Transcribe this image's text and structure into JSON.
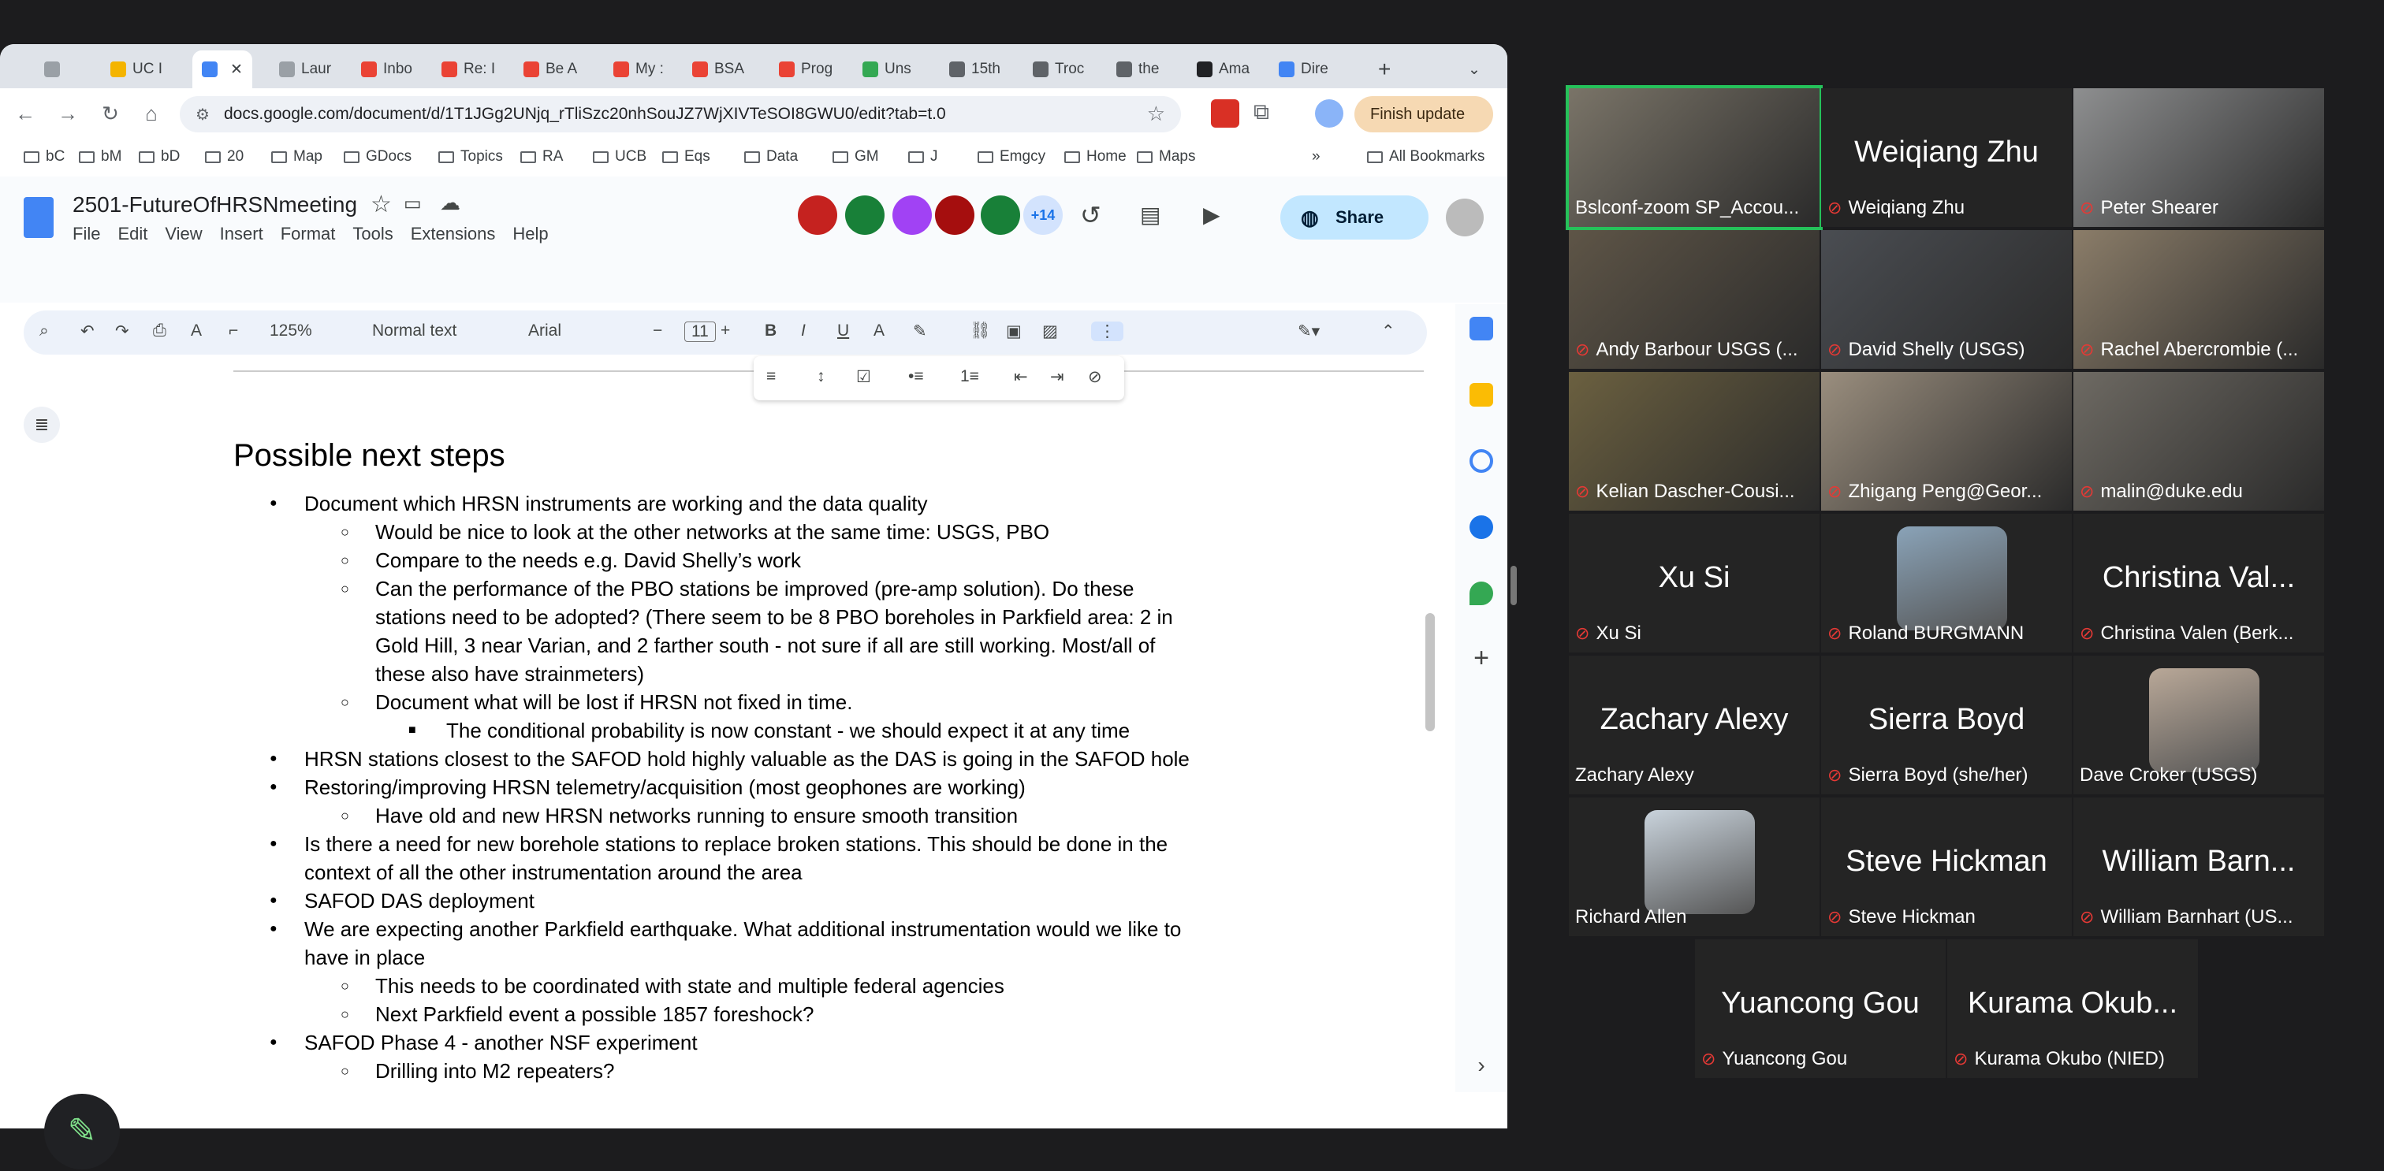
{
  "browser": {
    "tabs": [
      {
        "label": "UC I",
        "color": "#f4b400"
      },
      {
        "label": "",
        "color": "#4285f4",
        "active": true
      },
      {
        "label": "Laur",
        "color": "#9aa0a6"
      },
      {
        "label": "Inbo",
        "color": "#ea4335"
      },
      {
        "label": "Re: I",
        "color": "#ea4335"
      },
      {
        "label": "Be A",
        "color": "#ea4335"
      },
      {
        "label": "My :",
        "color": "#ea4335"
      },
      {
        "label": "BSA",
        "color": "#ea4335"
      },
      {
        "label": "Prog",
        "color": "#ea4335"
      },
      {
        "label": "Uns",
        "color": "#34a853"
      },
      {
        "label": "15th",
        "color": "#5f6368"
      },
      {
        "label": "Troc",
        "color": "#5f6368"
      },
      {
        "label": "the",
        "color": "#5f6368"
      },
      {
        "label": "Ama",
        "color": "#202124"
      },
      {
        "label": "Dire",
        "color": "#4285f4"
      }
    ],
    "url": "docs.google.com/document/d/1T1JGg2UNjq_rTliSzc20nhSouJZ7WjXIVTeSOI8GWU0/edit?tab=t.0",
    "finish_update": "Finish update",
    "bookmarks": [
      "bC",
      "bM",
      "bD",
      "20",
      "Map",
      "GDocs",
      "Topics",
      "RA",
      "UCB",
      "Eqs",
      "Data",
      "GM",
      "J",
      "Emgcy",
      "Home",
      "Maps"
    ],
    "more_bookmarks": "»",
    "all_bookmarks": "All Bookmarks"
  },
  "docs": {
    "title": "2501-FutureOfHRSNmeeting",
    "menus": [
      "File",
      "Edit",
      "View",
      "Insert",
      "Format",
      "Tools",
      "Extensions",
      "Help"
    ],
    "viewer_count": "+14",
    "share_label": "Share",
    "zoom": "125%",
    "style": "Normal text",
    "font": "Arial",
    "font_size": "11",
    "heading": "Possible next steps",
    "lines": [
      {
        "level": 1,
        "text": "Document which HRSN instruments are working and the data quality"
      },
      {
        "level": 2,
        "text": "Would be nice to look at the other networks at the same time: USGS, PBO"
      },
      {
        "level": 2,
        "text": "Compare to the needs e.g. David Shelly’s work"
      },
      {
        "level": 2,
        "text": "Can the performance of the PBO stations be improved (pre-amp solution).  Do these"
      },
      {
        "level": 0,
        "text": "stations need to be adopted? (There seem to be 8 PBO boreholes in Parkfield area: 2 in"
      },
      {
        "level": 0,
        "text": "Gold Hill, 3 near Varian, and 2 farther south - not sure if all are still working.  Most/all of"
      },
      {
        "level": 0,
        "text": "these also have strainmeters)"
      },
      {
        "level": 2,
        "text": "Document what will be lost if HRSN not fixed in time."
      },
      {
        "level": 3,
        "text": "The conditional probability is now constant - we should expect it at any time"
      },
      {
        "level": 1,
        "text": "HRSN stations closest to the SAFOD hold highly valuable as the DAS is going in the SAFOD hole"
      },
      {
        "level": 1,
        "text": "Restoring/improving HRSN telemetry/acquisition (most geophones are working)"
      },
      {
        "level": 2,
        "text": "Have old and new HRSN networks running to ensure smooth transition"
      },
      {
        "level": 1,
        "text": "Is there a need for new borehole stations to replace broken stations.  This should be done in the"
      },
      {
        "level": -1,
        "text": "context of all the other instrumentation around the area"
      },
      {
        "level": 1,
        "text": "SAFOD DAS deployment"
      },
      {
        "level": 1,
        "text": "We are expecting another Parkfield earthquake.  What additional instrumentation would we like to"
      },
      {
        "level": -1,
        "text": "have in place"
      },
      {
        "level": 2,
        "text": "This needs to be coordinated with state and multiple federal agencies"
      },
      {
        "level": 2,
        "text": "Next Parkfield event a possible 1857 foreshock?"
      },
      {
        "level": 1,
        "text": "SAFOD Phase 4 - another NSF experiment"
      },
      {
        "level": 2,
        "text": "Drilling into M2 repeaters?"
      }
    ]
  },
  "zoom": {
    "participants": [
      {
        "label": "Bslconf-zoom SP_Accou...",
        "video": "#7a7468",
        "muted": false,
        "highlight": true
      },
      {
        "label": "Weiqiang Zhu",
        "big": "Weiqiang Zhu",
        "muted": true
      },
      {
        "label": "Peter Shearer",
        "video": "#8e8f90",
        "muted": true
      },
      {
        "label": "Andy Barbour USGS (...",
        "video": "#5e5547",
        "muted": true
      },
      {
        "label": "David Shelly (USGS)",
        "video": "#4a4d52",
        "muted": true
      },
      {
        "label": "Rachel Abercrombie (...",
        "video": "#8b7d69",
        "muted": true
      },
      {
        "label": "Kelian Dascher-Cousi...",
        "video": "#6b6040",
        "muted": true
      },
      {
        "label": "Zhigang Peng@Geor...",
        "video": "#9a8e7e",
        "muted": true
      },
      {
        "label": "malin@duke.edu",
        "video": "#6e6a63",
        "muted": true
      },
      {
        "label": "Xu Si",
        "big": "Xu Si",
        "muted": true
      },
      {
        "label": "Roland BURGMANN",
        "photo": "#8aa3b8",
        "muted": true
      },
      {
        "label": "Christina Valen (Berk...",
        "big": "Christina Val...",
        "muted": true
      },
      {
        "label": "Zachary Alexy",
        "big": "Zachary Alexy",
        "muted": false
      },
      {
        "label": "Sierra Boyd (she/her)",
        "big": "Sierra Boyd",
        "muted": true
      },
      {
        "label": "Dave Croker (USGS)",
        "photo": "#b9a898",
        "muted": false
      },
      {
        "label": "Richard Allen",
        "photo": "#c9d3dc",
        "muted": false
      },
      {
        "label": "Steve Hickman",
        "big": "Steve Hickman",
        "muted": true
      },
      {
        "label": "William Barnhart (US...",
        "big": "William Barn...",
        "muted": true
      },
      {
        "label": "Yuancong Gou",
        "big": "Yuancong Gou",
        "muted": true
      },
      {
        "label": "Kurama Okubo (NIED)",
        "big": "Kurama Okub...",
        "muted": true
      }
    ]
  }
}
